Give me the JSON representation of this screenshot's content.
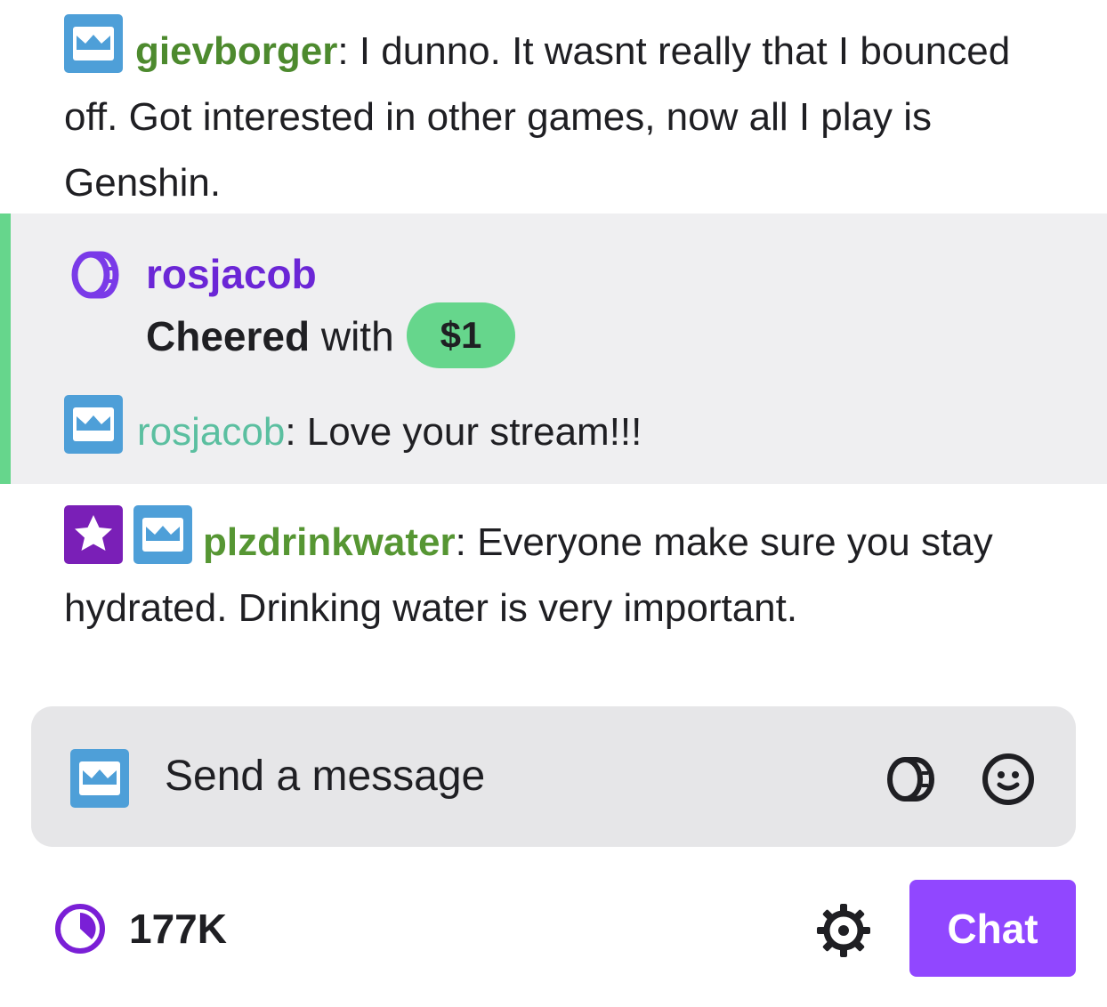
{
  "messages": [
    {
      "username": "gievborger",
      "username_color": "#4d8a2e",
      "separator": ":",
      "text": " I dunno. It wasnt really that I bounced off. Got interested in other games, now all I play is Genshin."
    },
    {
      "username": "plzdrinkwater",
      "username_color": "#569633",
      "separator": ":",
      "text": " Everyone make sure you stay hydrated. Drinking water is very important."
    }
  ],
  "cheer": {
    "username": "rosjacob",
    "action": "Cheered",
    "with_text": " with",
    "amount": "$1",
    "message_username": "rosjacob",
    "message_separator": ":",
    "message_text": " Love your stream!!!"
  },
  "input": {
    "placeholder": "Send a message"
  },
  "footer": {
    "points": "177K",
    "chat_button": "Chat"
  },
  "colors": {
    "accent": "#9147ff",
    "cheer_green": "#66d68c",
    "cheer_purple": "#6b26d6",
    "rosjacob_name": "#5bbfa0",
    "crown_badge": "#4e9fd8",
    "star_badge": "#7a1fb7"
  },
  "icons": [
    "crown-badge-icon",
    "star-badge-icon",
    "bits-icon",
    "emote-icon",
    "channel-points-icon",
    "gear-icon"
  ]
}
